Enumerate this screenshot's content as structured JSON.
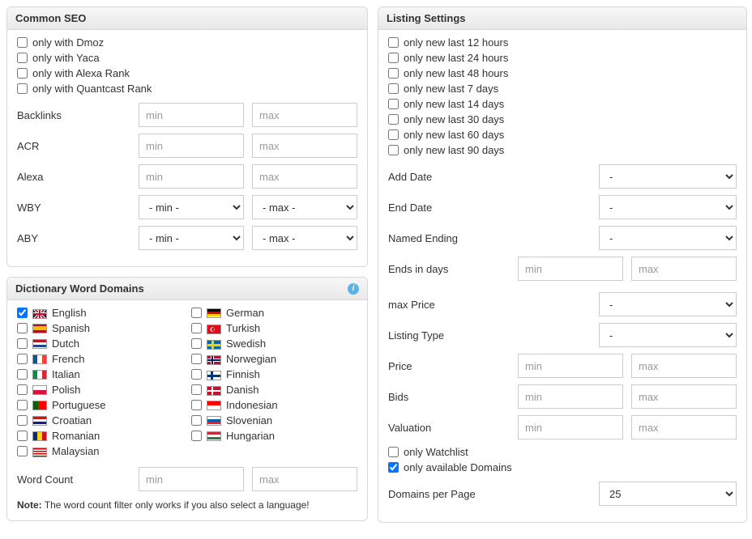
{
  "common_seo": {
    "title": "Common SEO",
    "checks": [
      {
        "label": "only with Dmoz",
        "checked": false
      },
      {
        "label": "only with Yaca",
        "checked": false
      },
      {
        "label": "only with Alexa Rank",
        "checked": false
      },
      {
        "label": "only with Quantcast Rank",
        "checked": false
      }
    ],
    "rows": [
      {
        "key": "backlinks",
        "label": "Backlinks",
        "type": "minmax-text",
        "min_ph": "min",
        "max_ph": "max"
      },
      {
        "key": "acr",
        "label": "ACR",
        "type": "minmax-text",
        "min_ph": "min",
        "max_ph": "max"
      },
      {
        "key": "alexa",
        "label": "Alexa",
        "type": "minmax-text",
        "min_ph": "min",
        "max_ph": "max"
      },
      {
        "key": "wby",
        "label": "WBY",
        "type": "minmax-select",
        "min_sel": "- min -",
        "max_sel": "- max -"
      },
      {
        "key": "aby",
        "label": "ABY",
        "type": "minmax-select",
        "min_sel": "- min -",
        "max_sel": "- max -"
      }
    ]
  },
  "dictionary": {
    "title": "Dictionary Word Domains",
    "left": [
      {
        "label": "English",
        "checked": true,
        "flag": "gb"
      },
      {
        "label": "Spanish",
        "checked": false,
        "flag": "es"
      },
      {
        "label": "Dutch",
        "checked": false,
        "flag": "nl"
      },
      {
        "label": "French",
        "checked": false,
        "flag": "fr"
      },
      {
        "label": "Italian",
        "checked": false,
        "flag": "it"
      },
      {
        "label": "Polish",
        "checked": false,
        "flag": "pl"
      },
      {
        "label": "Portuguese",
        "checked": false,
        "flag": "pt"
      },
      {
        "label": "Croatian",
        "checked": false,
        "flag": "hr"
      },
      {
        "label": "Romanian",
        "checked": false,
        "flag": "ro"
      },
      {
        "label": "Malaysian",
        "checked": false,
        "flag": "my"
      }
    ],
    "right": [
      {
        "label": "German",
        "checked": false,
        "flag": "de"
      },
      {
        "label": "Turkish",
        "checked": false,
        "flag": "tr"
      },
      {
        "label": "Swedish",
        "checked": false,
        "flag": "se"
      },
      {
        "label": "Norwegian",
        "checked": false,
        "flag": "no"
      },
      {
        "label": "Finnish",
        "checked": false,
        "flag": "fi"
      },
      {
        "label": "Danish",
        "checked": false,
        "flag": "dk"
      },
      {
        "label": "Indonesian",
        "checked": false,
        "flag": "id"
      },
      {
        "label": "Slovenian",
        "checked": false,
        "flag": "si"
      },
      {
        "label": "Hungarian",
        "checked": false,
        "flag": "hu"
      }
    ],
    "word_count": {
      "label": "Word Count",
      "min_ph": "min",
      "max_ph": "max"
    },
    "note_bold": "Note:",
    "note_text": " The word count filter only works if you also select a language!"
  },
  "listing": {
    "title": "Listing Settings",
    "time_checks": [
      {
        "label": "only new last 12 hours"
      },
      {
        "label": "only new last 24 hours"
      },
      {
        "label": "only new last 48 hours"
      },
      {
        "label": "only new last 7 days"
      },
      {
        "label": "only new last 14 days"
      },
      {
        "label": "only new last 30 days"
      },
      {
        "label": "only new last 60 days"
      },
      {
        "label": "only new last 90 days"
      }
    ],
    "add_date": {
      "label": "Add Date",
      "sel": "-"
    },
    "end_date": {
      "label": "End Date",
      "sel": "-"
    },
    "named_ending": {
      "label": "Named Ending",
      "sel": "-"
    },
    "ends_in_days": {
      "label": "Ends in days",
      "min_ph": "min",
      "max_ph": "max"
    },
    "max_price": {
      "label": "max Price",
      "sel": "-"
    },
    "listing_type": {
      "label": "Listing Type",
      "sel": "-"
    },
    "price": {
      "label": "Price",
      "min_ph": "min",
      "max_ph": "max"
    },
    "bids": {
      "label": "Bids",
      "min_ph": "min",
      "max_ph": "max"
    },
    "valuation": {
      "label": "Valuation",
      "min_ph": "min",
      "max_ph": "max"
    },
    "only_watchlist": {
      "label": "only Watchlist",
      "checked": false
    },
    "only_available": {
      "label": "only available Domains",
      "checked": true
    },
    "per_page": {
      "label": "Domains per Page",
      "sel": "25"
    }
  }
}
